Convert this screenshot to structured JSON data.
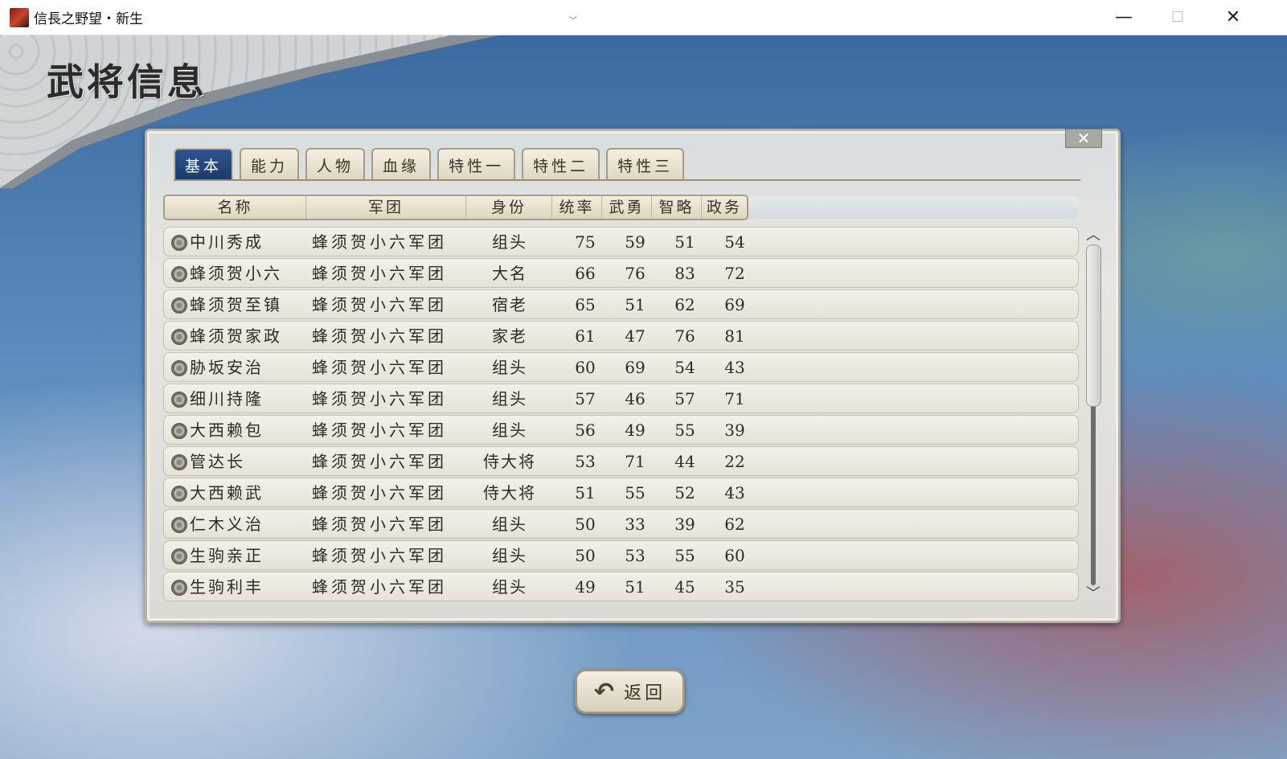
{
  "window": {
    "title": "信長之野望・新生",
    "minimize": "—",
    "maximize": "☐",
    "close": "✕"
  },
  "page_title": "武将信息",
  "panel": {
    "close": "✕"
  },
  "tabs": [
    {
      "label": "基本",
      "active": true
    },
    {
      "label": "能力",
      "active": false
    },
    {
      "label": "人物",
      "active": false
    },
    {
      "label": "血缘",
      "active": false
    },
    {
      "label": "特性一",
      "active": false
    },
    {
      "label": "特性二",
      "active": false
    },
    {
      "label": "特性三",
      "active": false
    }
  ],
  "columns": {
    "name": "名称",
    "corps": "军团",
    "rank": "身份",
    "stat1": "统率",
    "stat2": "武勇",
    "stat3": "智略",
    "stat4": "政务"
  },
  "rows": [
    {
      "name": "中川秀成",
      "corps": "蜂须贺小六军团",
      "rank": "组头",
      "s1": "75",
      "s2": "59",
      "s3": "51",
      "s4": "54"
    },
    {
      "name": "蜂须贺小六",
      "corps": "蜂须贺小六军团",
      "rank": "大名",
      "s1": "66",
      "s2": "76",
      "s3": "83",
      "s4": "72"
    },
    {
      "name": "蜂须贺至镇",
      "corps": "蜂须贺小六军团",
      "rank": "宿老",
      "s1": "65",
      "s2": "51",
      "s3": "62",
      "s4": "69"
    },
    {
      "name": "蜂须贺家政",
      "corps": "蜂须贺小六军团",
      "rank": "家老",
      "s1": "61",
      "s2": "47",
      "s3": "76",
      "s4": "81"
    },
    {
      "name": "胁坂安治",
      "corps": "蜂须贺小六军团",
      "rank": "组头",
      "s1": "60",
      "s2": "69",
      "s3": "54",
      "s4": "43"
    },
    {
      "name": "细川持隆",
      "corps": "蜂须贺小六军团",
      "rank": "组头",
      "s1": "57",
      "s2": "46",
      "s3": "57",
      "s4": "71"
    },
    {
      "name": "大西赖包",
      "corps": "蜂须贺小六军团",
      "rank": "组头",
      "s1": "56",
      "s2": "49",
      "s3": "55",
      "s4": "39"
    },
    {
      "name": "管达长",
      "corps": "蜂须贺小六军团",
      "rank": "侍大将",
      "s1": "53",
      "s2": "71",
      "s3": "44",
      "s4": "22"
    },
    {
      "name": "大西赖武",
      "corps": "蜂须贺小六军团",
      "rank": "侍大将",
      "s1": "51",
      "s2": "55",
      "s3": "52",
      "s4": "43"
    },
    {
      "name": "仁木义治",
      "corps": "蜂须贺小六军团",
      "rank": "组头",
      "s1": "50",
      "s2": "33",
      "s3": "39",
      "s4": "62"
    },
    {
      "name": "生驹亲正",
      "corps": "蜂须贺小六军团",
      "rank": "组头",
      "s1": "50",
      "s2": "53",
      "s3": "55",
      "s4": "60"
    },
    {
      "name": "生驹利丰",
      "corps": "蜂须贺小六军团",
      "rank": "组头",
      "s1": "49",
      "s2": "51",
      "s3": "45",
      "s4": "35"
    }
  ],
  "scroll": {
    "up": "︿",
    "down": "﹀"
  },
  "sort_indicator": "﹀",
  "back_button": {
    "label": "返回",
    "icon": "undo-arrow-icon",
    "icon_glyph": "↶"
  }
}
